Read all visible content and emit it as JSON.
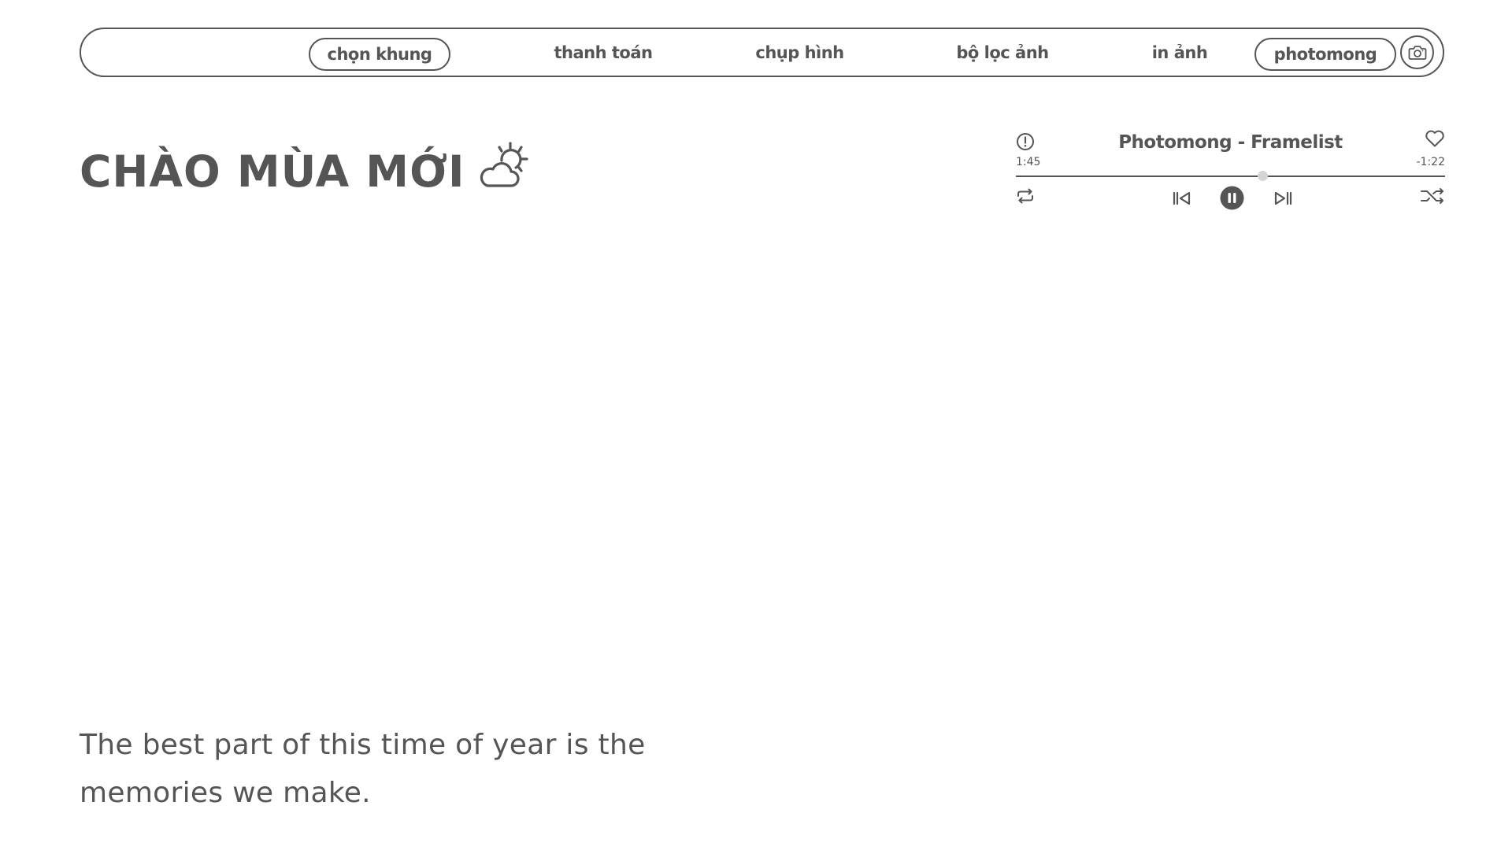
{
  "nav": {
    "items": [
      {
        "label": "chọn khung",
        "active": true
      },
      {
        "label": "thanh toán",
        "active": false
      },
      {
        "label": "chụp hình",
        "active": false
      },
      {
        "label": "bộ lọc ảnh",
        "active": false
      },
      {
        "label": "in ảnh",
        "active": false
      },
      {
        "label": "photomong",
        "active": true
      }
    ],
    "camera_icon": "camera-icon"
  },
  "hero": {
    "title": "CHÀO MÙA MỚI",
    "icon": "partly-sunny-icon"
  },
  "player": {
    "title": "Photomong - Framelist",
    "elapsed": "1:45",
    "remaining": "-1:22",
    "progress": 0.575,
    "state": "playing",
    "icons": [
      "info-icon",
      "heart-icon",
      "repeat-icon",
      "previous-icon",
      "pause-icon",
      "next-icon",
      "shuffle-icon"
    ]
  },
  "tagline": {
    "text": "The best part of this time of year is the memories we make."
  },
  "colors": {
    "primary": "#555555",
    "background": "#ffffff",
    "knob": "#d4d4d4"
  }
}
